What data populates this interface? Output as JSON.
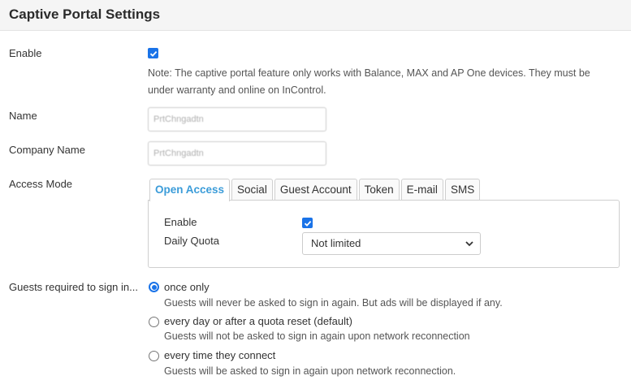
{
  "header": {
    "title": "Captive Portal Settings"
  },
  "enable": {
    "label": "Enable",
    "checked": true,
    "note_line1": "Note: The captive portal feature only works with Balance, MAX and AP One devices. They must be",
    "note_line2": "under warranty and online on InControl."
  },
  "name": {
    "label": "Name",
    "value": "PrtChngadtn"
  },
  "company": {
    "label": "Company Name",
    "value": "PrtChngadtn"
  },
  "access_mode": {
    "label": "Access Mode",
    "tabs": [
      "Open Access",
      "Social",
      "Guest Account",
      "Token",
      "E-mail",
      "SMS"
    ],
    "active_tab": "Open Access",
    "panel": {
      "enable_label": "Enable",
      "enable_checked": true,
      "daily_quota_label": "Daily Quota",
      "daily_quota_value": "Not limited"
    }
  },
  "sign_in": {
    "label": "Guests required to sign in...",
    "options": [
      {
        "label": "once only",
        "description": "Guests will never be asked to sign in again. But ads will be displayed if any.",
        "checked": true
      },
      {
        "label": "every day or after a quota reset (default)",
        "description": "Guests will not be asked to sign in again upon network reconnection",
        "checked": false
      },
      {
        "label": "every time they connect",
        "description": "Guests will be asked to sign in again upon network reconnection.",
        "checked": false
      }
    ]
  },
  "colors": {
    "accent": "#1a73e8",
    "active_tab": "#3b9cd9"
  }
}
